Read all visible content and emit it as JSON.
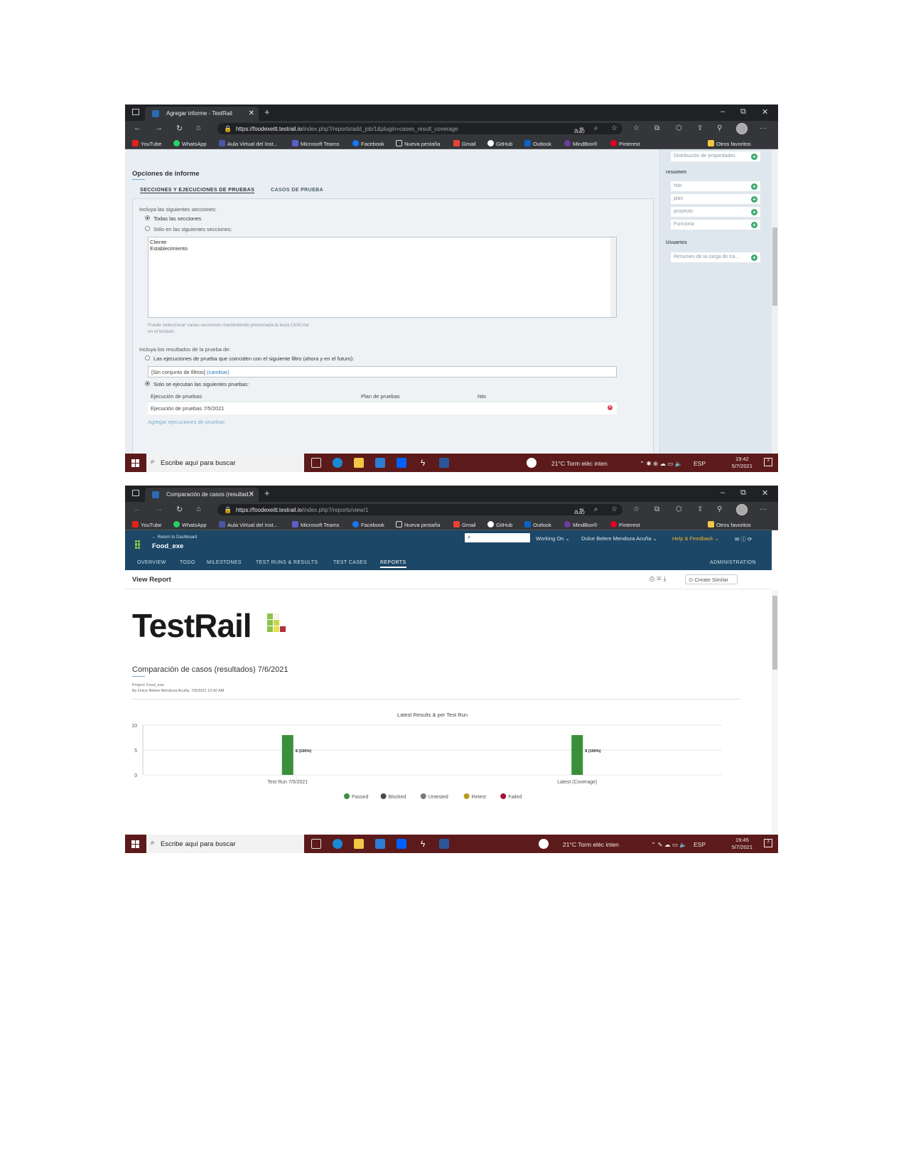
{
  "browser": {
    "new_tab": "+",
    "minimize": "–",
    "restore": "⧉",
    "close": "✕",
    "back": "←",
    "forward": "→",
    "reload": "↻",
    "home": "⌂",
    "more": "···",
    "zoom_badge": "aあ"
  },
  "bookmarks": [
    "YouTube",
    "WhatsApp",
    "Aula Virtual del Inst...",
    "Microsoft Teams",
    "Facebook",
    "Nueva pestaña",
    "Gmail",
    "GitHub",
    "Outlook",
    "MindBox®",
    "Pinterest"
  ],
  "other_favorites": "Otros favoritos",
  "shot1": {
    "tab_title": "Agregar informe - TestRail",
    "url_main": "https://foodexeitt.testrail.io",
    "url_rest": "/index.php?/reports/add_job/1&plugin=cases_result_coverage",
    "section_title": "Opciones de informe",
    "tabs": [
      "SECCIONES Y EJECUCIONES DE PRUEBAS",
      "CASOS DE PRUEBA"
    ],
    "include_sections_label": "Incluya las siguientes secciones:",
    "opt_all_sections": "Todas las secciones",
    "opt_only_sections": "Sólo en las siguientes secciones:",
    "sections_list": [
      "Cliente",
      "Establecimiento"
    ],
    "hint_line1": "Puede seleccionar varias secciones manteniendo presionada la tecla Ctrl/Cmd",
    "hint_line2": "en el teclado.",
    "include_results_label": "Incluya los resultados de la prueba de:",
    "opt_filter_runs": "Las ejecuciones de prueba que coinciden con el siguiente filtro (ahora y en el futuro):",
    "filter_text": "[Sin conjunto de filtros]",
    "filter_change": "(cambiar)",
    "opt_only_runs": "Solo se ejecutan las siguientes pruebas:",
    "table_headers": [
      "Ejecución de pruebas",
      "Plan de pruebas",
      "hito"
    ],
    "table_row": "Ejecución de pruebas 7/5/2021",
    "add_runs_link": "Agregar ejecuciones de pruebas",
    "right_top_item": "Distribución de propiedades",
    "right_group1": "resumen",
    "right_items1": [
      "hito",
      "plan",
      "proyecto",
      "Funciona"
    ],
    "right_group2": "Usuarios",
    "right_items2": [
      "Resumen de la carga de tra..."
    ],
    "clock_time": "19:42",
    "clock_date": "5/7/2021"
  },
  "shot2": {
    "tab_title": "Comparación de casos (resultad...",
    "url_main": "https://foodexeitt.testrail.io",
    "url_rest": "/index.php?/reports/view/1",
    "return_link": "← Return to Dashboard",
    "project_name": "Food_exe",
    "working_on": "Working On ⌄",
    "user_name": "Dulce Belem Mendoza Acuña ⌄",
    "help": "Help & Feedback ⌄",
    "nav_tabs": [
      "OVERVIEW",
      "TODO",
      "MILESTONES",
      "TEST RUNS & RESULTS",
      "TEST CASES",
      "REPORTS"
    ],
    "administration": "ADMINISTRATION",
    "view_report": "View Report",
    "create_similar": "⊙ Create Similar",
    "brand": "TestRail",
    "report_title": "Comparación de casos (resultados) 7/6/2021",
    "project_line": "Project: Food_exe",
    "by_line": "By Dulce Belem Mendoza Acuña, 7/6/2021 12:42 AM",
    "clock_time": "19:45",
    "clock_date": "5/7/2021"
  },
  "taskbar": {
    "search_placeholder": "Escribe aquí para buscar",
    "weather": "21°C  Torm eléc inten",
    "lang": "ESP"
  },
  "chart_data": {
    "type": "bar",
    "title": "Latest Results & per Test Run",
    "categories": [
      "Test Run 7/5/2021",
      "Latest (Coverage)"
    ],
    "series": [
      {
        "name": "Passed",
        "values": [
          8,
          8
        ]
      }
    ],
    "data_labels": [
      "8 (100%)",
      "8 (100%)"
    ],
    "ylim": [
      0,
      10
    ],
    "yticks": [
      0,
      5,
      10
    ],
    "legend": [
      {
        "name": "Passed",
        "color": "#3b8f3b"
      },
      {
        "name": "Blocked",
        "color": "#4a4a4a"
      },
      {
        "name": "Untested",
        "color": "#7a7a7a"
      },
      {
        "name": "Retest",
        "color": "#b79b1c"
      },
      {
        "name": "Failed",
        "color": "#a3123a"
      }
    ],
    "legend_position": "bottom",
    "grid": true
  }
}
